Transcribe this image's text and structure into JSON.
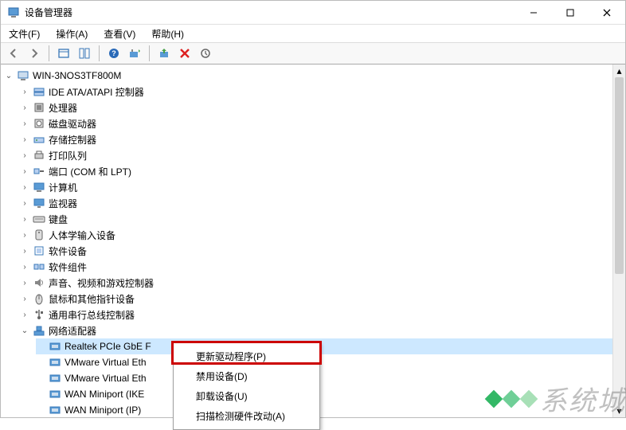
{
  "titlebar": {
    "title": "设备管理器"
  },
  "menubar": {
    "file": "文件(F)",
    "action": "操作(A)",
    "view": "查看(V)",
    "help": "帮助(H)"
  },
  "tree": {
    "root": "WIN-3NOS3TF800M",
    "nodes": [
      {
        "label": "IDE ATA/ATAPI 控制器",
        "icon": "ide"
      },
      {
        "label": "处理器",
        "icon": "cpu"
      },
      {
        "label": "磁盘驱动器",
        "icon": "disk"
      },
      {
        "label": "存储控制器",
        "icon": "storage"
      },
      {
        "label": "打印队列",
        "icon": "printer"
      },
      {
        "label": "端口 (COM 和 LPT)",
        "icon": "port"
      },
      {
        "label": "计算机",
        "icon": "computer"
      },
      {
        "label": "监视器",
        "icon": "monitor"
      },
      {
        "label": "键盘",
        "icon": "keyboard"
      },
      {
        "label": "人体学输入设备",
        "icon": "hid"
      },
      {
        "label": "软件设备",
        "icon": "softdev"
      },
      {
        "label": "软件组件",
        "icon": "softcomp"
      },
      {
        "label": "声音、视频和游戏控制器",
        "icon": "sound"
      },
      {
        "label": "鼠标和其他指针设备",
        "icon": "mouse"
      },
      {
        "label": "通用串行总线控制器",
        "icon": "usb"
      }
    ],
    "network": {
      "label": "网络适配器",
      "children": [
        "Realtek PCIe GbE F",
        "VMware Virtual Eth",
        "VMware Virtual Eth",
        "WAN Miniport (IKE",
        "WAN Miniport (IP)"
      ]
    }
  },
  "context_menu": {
    "update_driver": "更新驱动程序(P)",
    "disable": "禁用设备(D)",
    "uninstall": "卸载设备(U)",
    "scan": "扫描检测硬件改动(A)"
  },
  "watermark": {
    "text": "系统城"
  }
}
